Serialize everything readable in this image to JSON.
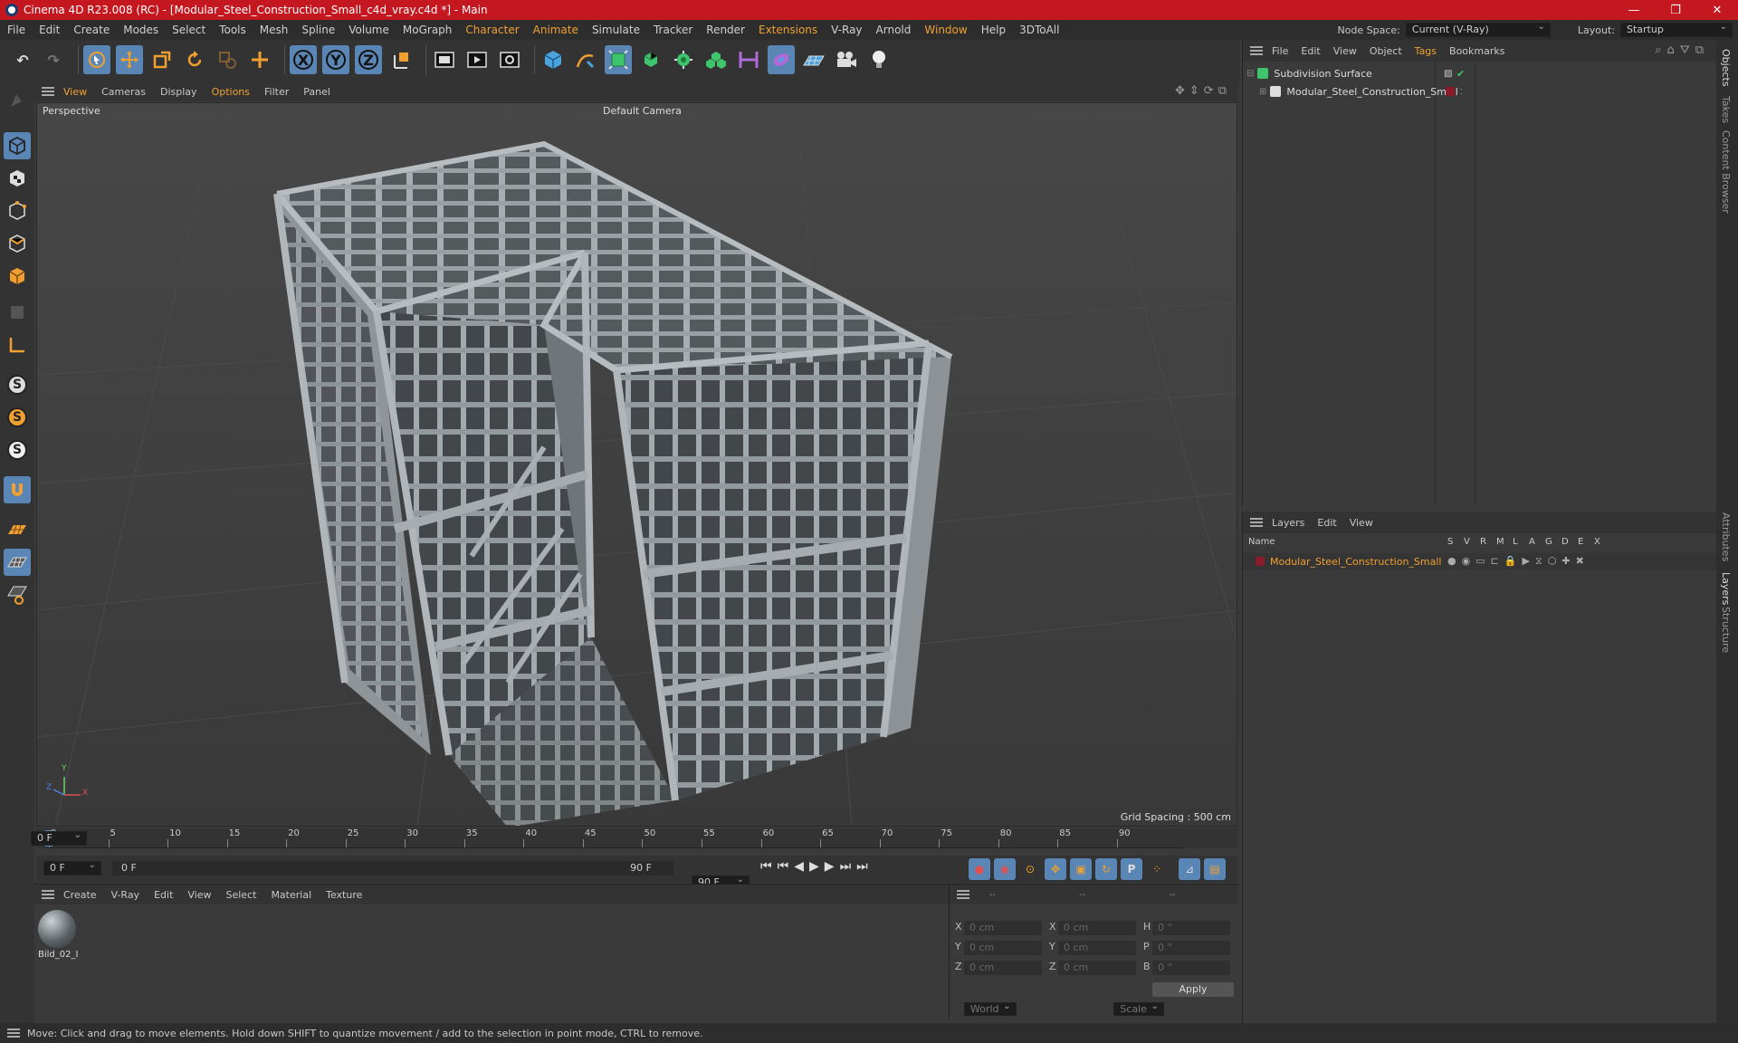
{
  "window": {
    "title": "Cinema 4D R23.008 (RC) - [Modular_Steel_Construction_Small_c4d_vray.c4d *] - Main",
    "controls": [
      "—",
      "❐",
      "✕"
    ]
  },
  "menubar": {
    "items": [
      {
        "label": "File"
      },
      {
        "label": "Edit"
      },
      {
        "label": "Create"
      },
      {
        "label": "Modes"
      },
      {
        "label": "Select"
      },
      {
        "label": "Tools"
      },
      {
        "label": "Mesh"
      },
      {
        "label": "Spline"
      },
      {
        "label": "Volume"
      },
      {
        "label": "MoGraph"
      },
      {
        "label": "Character"
      },
      {
        "label": "Animate"
      },
      {
        "label": "Simulate"
      },
      {
        "label": "Tracker"
      },
      {
        "label": "Render"
      },
      {
        "label": "Extensions"
      },
      {
        "label": "V-Ray"
      },
      {
        "label": "Arnold"
      },
      {
        "label": "Window"
      },
      {
        "label": "Help"
      },
      {
        "label": "3DToAll"
      }
    ],
    "node_space_label": "Node Space:",
    "node_space_value": "Current (V-Ray)",
    "layout_label": "Layout:",
    "layout_value": "Startup"
  },
  "viewport": {
    "menu": [
      "View",
      "Cameras",
      "Display",
      "Options",
      "Filter",
      "Panel"
    ],
    "projection": "Perspective",
    "camera": "Default Camera",
    "grid_spacing": "Grid Spacing : 500 cm",
    "axis_y": "Y",
    "axis_x": "X",
    "axis_z": "Z"
  },
  "timeline": {
    "ticks": [
      "0",
      "5",
      "10",
      "15",
      "20",
      "25",
      "30",
      "35",
      "40",
      "45",
      "50",
      "55",
      "60",
      "65",
      "70",
      "75",
      "80",
      "85",
      "90"
    ],
    "current_frame": "0 F",
    "start_field": "0 F",
    "range_start": "0 F",
    "range_end": "90 F",
    "end_field": "90 F"
  },
  "material_manager": {
    "menu": [
      "Create",
      "V-Ray",
      "Edit",
      "View",
      "Select",
      "Material",
      "Texture"
    ],
    "materials": [
      {
        "name": "Bild_02_I"
      }
    ]
  },
  "coordinates": {
    "header": [
      "--",
      "--",
      "--"
    ],
    "rows": [
      {
        "a": "X",
        "av": "0 cm",
        "b": "X",
        "bv": "0 cm",
        "c": "H",
        "cv": "0 °"
      },
      {
        "a": "Y",
        "av": "0 cm",
        "b": "Y",
        "bv": "0 cm",
        "c": "P",
        "cv": "0 °"
      },
      {
        "a": "Z",
        "av": "0 cm",
        "b": "Z",
        "bv": "0 cm",
        "c": "B",
        "cv": "0 °"
      }
    ],
    "space": "World",
    "mode": "Scale",
    "apply": "Apply"
  },
  "object_manager": {
    "menu": [
      "File",
      "Edit",
      "View",
      "Object",
      "Tags",
      "Bookmarks"
    ],
    "objects": [
      {
        "name": "Subdivision Surface"
      },
      {
        "name": "Modular_Steel_Construction_Small"
      }
    ]
  },
  "layer_manager": {
    "menu": [
      "Layers",
      "Edit",
      "View"
    ],
    "columns": [
      "Name",
      "S",
      "V",
      "R",
      "M",
      "L",
      "A",
      "G",
      "D",
      "E",
      "X"
    ],
    "layers": [
      {
        "name": "Modular_Steel_Construction_Small",
        "color": "#8b1a2a"
      }
    ]
  },
  "right_tabs": [
    "Objects",
    "Takes",
    "Content Browser",
    "Attributes",
    "Layers",
    "Structure"
  ],
  "status": "Move: Click and drag to move elements. Hold down SHIFT to quantize movement / add to the selection in point mode, CTRL to remove.",
  "colors": {
    "titlebar": "#c4171f",
    "accent_orange": "#f0a030",
    "selection_blue": "#5a86b5"
  }
}
